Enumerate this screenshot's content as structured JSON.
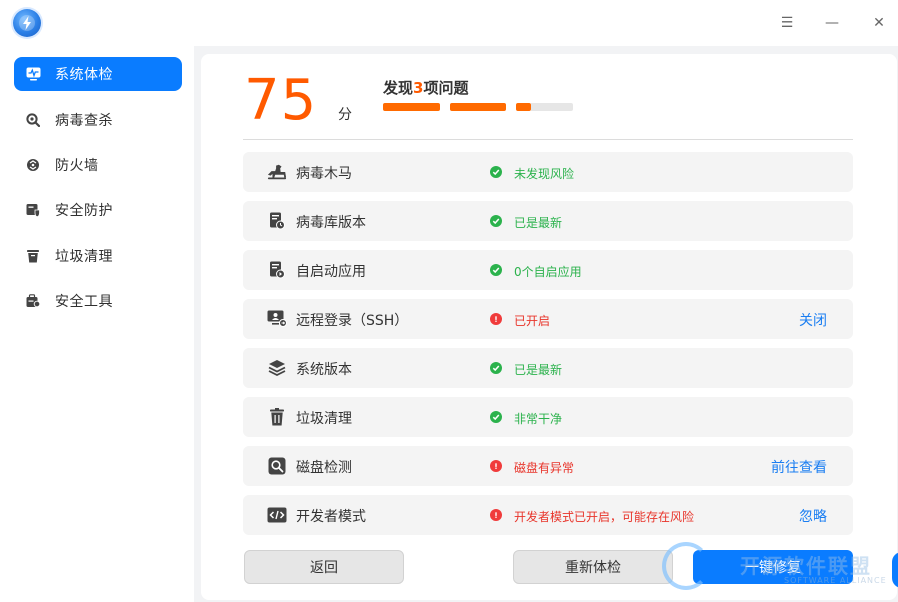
{
  "titlebar": {
    "menu_icon": "☰",
    "min_icon": "—",
    "close_icon": "✕"
  },
  "sidebar": {
    "items": [
      {
        "label": "系统体检",
        "icon": "monitor-pulse-icon",
        "active": true
      },
      {
        "label": "病毒查杀",
        "icon": "magnifier-icon",
        "active": false
      },
      {
        "label": "防火墙",
        "icon": "firewall-icon",
        "active": false
      },
      {
        "label": "安全防护",
        "icon": "shield-box-icon",
        "active": false
      },
      {
        "label": "垃圾清理",
        "icon": "trash-icon",
        "active": false
      },
      {
        "label": "安全工具",
        "icon": "toolbox-icon",
        "active": false
      }
    ]
  },
  "summary": {
    "score": "75",
    "score_unit": "分",
    "issue_prefix": "发现",
    "issue_count": "3",
    "issue_suffix": "项问题"
  },
  "checks": [
    {
      "label": "病毒木马",
      "icon": "trojan-horse-icon",
      "status": "未发现风险",
      "state": "ok",
      "action": ""
    },
    {
      "label": "病毒库版本",
      "icon": "virus-db-icon",
      "status": "已是最新",
      "state": "ok",
      "action": ""
    },
    {
      "label": "自启动应用",
      "icon": "autostart-app-icon",
      "status": "0个自启应用",
      "state": "ok",
      "action": ""
    },
    {
      "label": "远程登录（SSH）",
      "icon": "remote-login-icon",
      "status": "已开启",
      "state": "warn",
      "action": "关闭"
    },
    {
      "label": "系统版本",
      "icon": "layers-icon",
      "status": "已是最新",
      "state": "ok",
      "action": ""
    },
    {
      "label": "垃圾清理",
      "icon": "trash-icon",
      "status": "非常干净",
      "state": "ok",
      "action": ""
    },
    {
      "label": "磁盘检测",
      "icon": "disk-check-icon",
      "status": "磁盘有异常",
      "state": "warn",
      "action": "前往查看"
    },
    {
      "label": "开发者模式",
      "icon": "code-icon",
      "status": "开发者模式已开启，可能存在风险",
      "state": "warn",
      "action": "忽略"
    }
  ],
  "buttons": {
    "back": "返回",
    "recheck": "重新体检",
    "fix": "一键修复"
  },
  "watermark": {
    "text": "开源软件联盟",
    "sub": "SOFTWARE ALLIANCE"
  },
  "colors": {
    "accent": "#0a7cff",
    "score": "#ff5a00",
    "ok": "#2bb24c",
    "warn": "#e8342a"
  }
}
